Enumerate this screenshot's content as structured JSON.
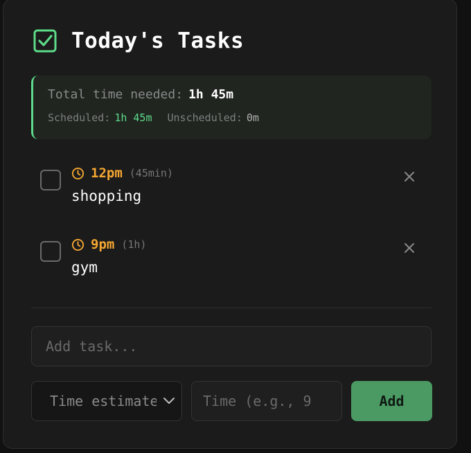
{
  "header": {
    "title": "Today's Tasks",
    "icon": "checkbox-checked-icon"
  },
  "summary": {
    "total_label": "Total time needed:",
    "total_value": "1h 45m",
    "scheduled_label": "Scheduled:",
    "scheduled_value": "1h 45m",
    "unscheduled_label": "Unscheduled:",
    "unscheduled_value": "0m"
  },
  "tasks": [
    {
      "time": "12pm",
      "duration": "(45min)",
      "name": "shopping",
      "done": false
    },
    {
      "time": "9pm",
      "duration": "(1h)",
      "name": "gym",
      "done": false
    }
  ],
  "form": {
    "task_placeholder": "Add task...",
    "estimate_placeholder": "Time estimate",
    "time_placeholder": "Time (e.g., 9",
    "add_label": "Add"
  },
  "colors": {
    "accent_green": "#5ddc8a",
    "time_orange": "#f5a731",
    "button_green": "#4b9a64"
  }
}
